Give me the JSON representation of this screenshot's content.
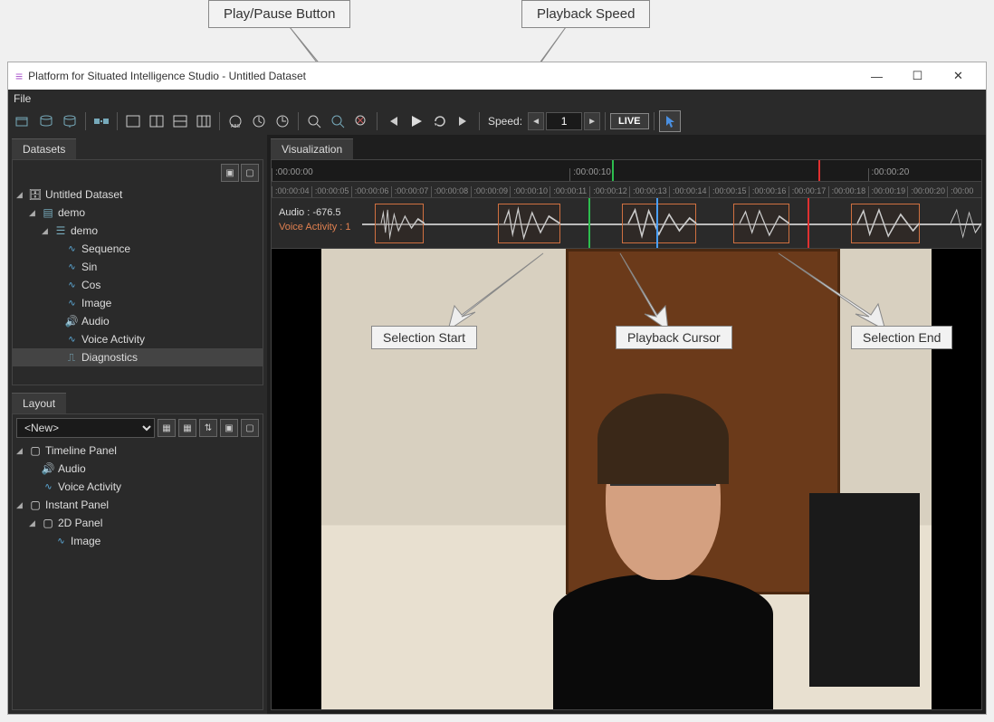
{
  "callouts": {
    "play_pause": "Play/Pause Button",
    "playback_speed": "Playback Speed",
    "selection_start": "Selection Start",
    "playback_cursor": "Playback Cursor",
    "selection_end": "Selection End"
  },
  "titlebar": {
    "title": "Platform for Situated Intelligence Studio - Untitled Dataset"
  },
  "menubar": {
    "file": "File"
  },
  "toolbar": {
    "speed_label": "Speed:",
    "speed_value": "1",
    "live": "LIVE"
  },
  "datasets": {
    "tab": "Datasets",
    "root": "Untitled Dataset",
    "session": "demo",
    "partition": "demo",
    "streams": [
      "Sequence",
      "Sin",
      "Cos",
      "Image",
      "Audio",
      "Voice Activity",
      "Diagnostics"
    ]
  },
  "layout": {
    "tab": "Layout",
    "select": "<New>",
    "timeline_panel": "Timeline Panel",
    "audio": "Audio",
    "voice_activity": "Voice Activity",
    "instant_panel": "Instant Panel",
    "panel_2d": "2D Panel",
    "image": "Image"
  },
  "visualization": {
    "tab": "Visualization",
    "ruler_major": [
      ":00:00:00",
      ":00:00:10",
      ":00:00:20"
    ],
    "ruler_minor": [
      ":00:00:04",
      ":00:00:05",
      ":00:00:06",
      ":00:00:07",
      ":00:00:08",
      ":00:00:09",
      ":00:00:10",
      ":00:00:11",
      ":00:00:12",
      ":00:00:13",
      ":00:00:14",
      ":00:00:15",
      ":00:00:16",
      ":00:00:17",
      ":00:00:18",
      ":00:00:19",
      ":00:00:20",
      ":00:00"
    ],
    "audio_label": "Audio",
    "audio_value": "-676.5",
    "va_label": "Voice Activity",
    "va_value": "1"
  }
}
